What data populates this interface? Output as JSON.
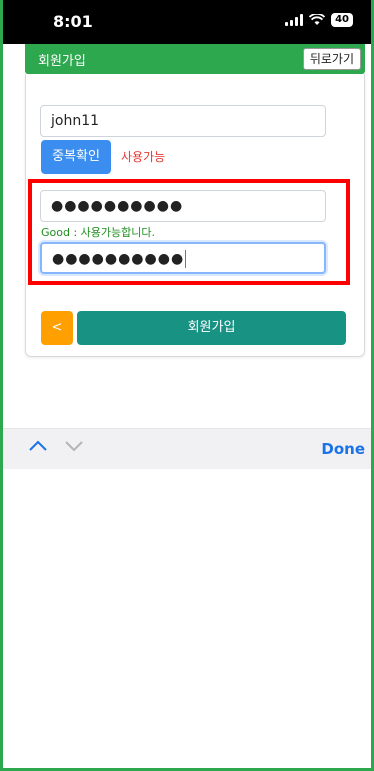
{
  "status": {
    "time": "8:01",
    "battery": "40"
  },
  "header": {
    "title": "회원가입",
    "back_label": "뒤로가기"
  },
  "form": {
    "username_value": "john11",
    "dup_check_label": "중복확인",
    "availability_text": "사용가능",
    "password_value": "●●●●●●●●●●",
    "password_feedback": "Good : 사용가능합니다.",
    "confirm_value": "●●●●●●●●●●",
    "prev_label": "<",
    "signup_label": "회원가입"
  },
  "keyboard": {
    "done_label": "Done",
    "icons": [
      "chevron-up-icon",
      "chevron-down-icon"
    ]
  },
  "colors": {
    "accent_green": "#2ea84e",
    "teal_button": "#179283",
    "orange_button": "#ff9f00",
    "blue_button": "#3b8ef0",
    "highlight_red": "#ff0000"
  }
}
